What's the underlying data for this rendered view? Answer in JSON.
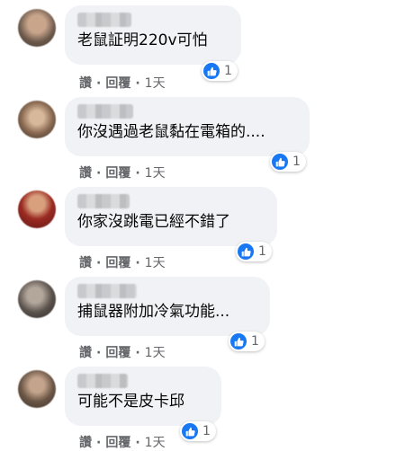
{
  "comments": [
    {
      "text": "老鼠証明220v可怕",
      "action_read": "讚",
      "action_reply": "回覆",
      "time": "1天",
      "reactions": "1"
    },
    {
      "text": "你沒遇過老鼠黏在電箱的....",
      "action_read": "讚",
      "action_reply": "回覆",
      "time": "1天",
      "reactions": "1"
    },
    {
      "text": "你家沒跳電已經不錯了",
      "action_read": "讚",
      "action_reply": "回覆",
      "time": "1天",
      "reactions": "1"
    },
    {
      "text": "捕鼠器附加冷氣功能...",
      "action_read": "讚",
      "action_reply": "回覆",
      "time": "1天",
      "reactions": "1"
    },
    {
      "text": "可能不是皮卡邱",
      "action_read": "讚",
      "action_reply": "回覆",
      "time": "1天",
      "reactions": "1"
    }
  ],
  "icons": {
    "reaction": "like-icon",
    "sep": "·"
  },
  "colors": {
    "bubble": "#f0f2f5",
    "like": "#1877f2",
    "meta": "#65676b"
  }
}
